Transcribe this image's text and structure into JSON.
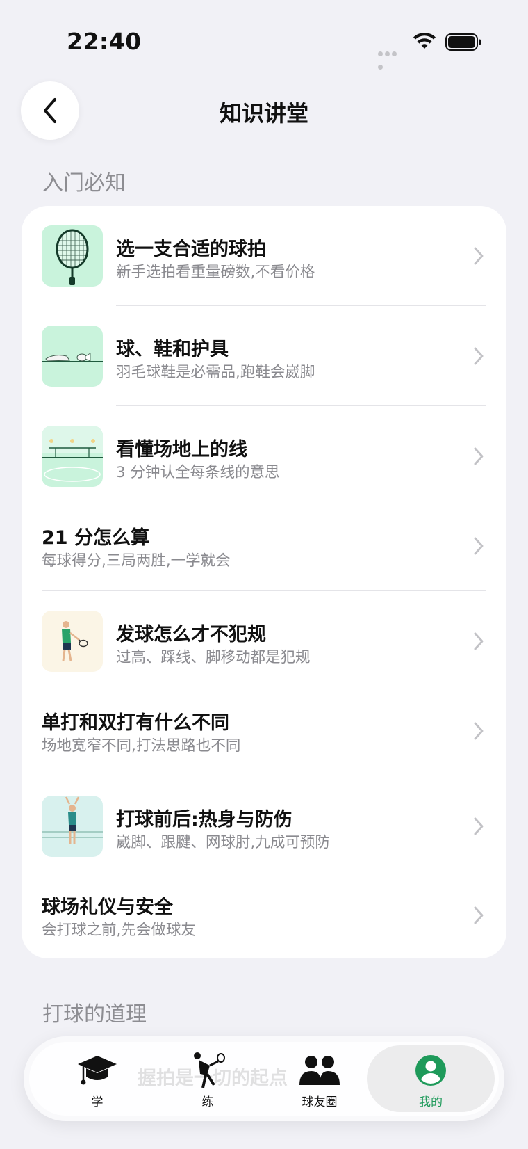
{
  "status_bar": {
    "time": "22:40"
  },
  "header": {
    "title": "知识讲堂"
  },
  "sections": [
    {
      "title": "入门必知"
    },
    {
      "title": "打球的道理"
    }
  ],
  "lessons": [
    {
      "title": "选一支合适的球拍",
      "subtitle": "新手选拍看重量磅数,不看价格",
      "thumbnail": "racket-thumbnail"
    },
    {
      "title": "球、鞋和护具",
      "subtitle": "羽毛球鞋是必需品,跑鞋会崴脚",
      "thumbnail": "gear-thumbnail"
    },
    {
      "title": "看懂场地上的线",
      "subtitle": "3 分钟认全每条线的意思",
      "thumbnail": "court-thumbnail"
    },
    {
      "title": "21 分怎么算",
      "subtitle": "每球得分,三局两胜,一学就会"
    },
    {
      "title": "发球怎么才不犯规",
      "subtitle": "过高、踩线、脚移动都是犯规",
      "thumbnail": "serve-thumbnail"
    },
    {
      "title": "单打和双打有什么不同",
      "subtitle": "场地宽窄不同,打法思路也不同"
    },
    {
      "title": "打球前后:热身与防伤",
      "subtitle": "崴脚、跟腱、网球肘,九成可预防",
      "thumbnail": "warmup-thumbnail"
    },
    {
      "title": "球场礼仪与安全",
      "subtitle": "会打球之前,先会做球友"
    }
  ],
  "tab_bar": {
    "tabs": [
      {
        "label": "学",
        "icon": "graduation-cap-icon"
      },
      {
        "label": "练",
        "icon": "player-icon"
      },
      {
        "label": "球友圈",
        "icon": "people-icon"
      },
      {
        "label": "我的",
        "icon": "profile-icon"
      }
    ],
    "active": "我的",
    "bleed_text": "握拍是一切的起点"
  },
  "colors": {
    "accent": "#1e9a5a",
    "background": "#f1f1f6",
    "card": "#ffffff",
    "thumb_green": "#c9f3dc"
  }
}
